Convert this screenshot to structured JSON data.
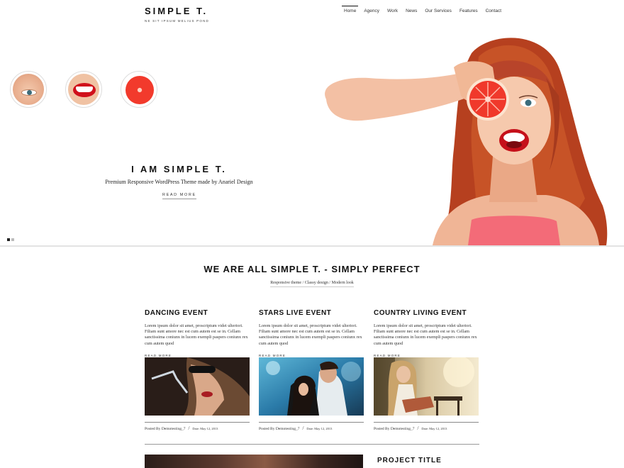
{
  "header": {
    "logo": "SIMPLE T.",
    "tagline": "NE SIT IPSUM MELIUS POND",
    "nav": [
      "Home",
      "Agency",
      "Work",
      "News",
      "Our Services",
      "Features",
      "Contact"
    ],
    "active_nav": "Home"
  },
  "hero": {
    "title": "I AM SIMPLE T.",
    "subtitle": "Premium Responsive WordPress Theme made by Anariel Design",
    "read_more": "READ MORE",
    "slides": 2,
    "active_slide": 1
  },
  "intro": {
    "title": "WE ARE ALL SIMPLE T. - SIMPLY PERFECT",
    "subtitle": "Responsive theme / Classy design / Modern look"
  },
  "posts": [
    {
      "title": "DANCING EVENT",
      "excerpt": "Lorem ipsum dolor sit amet, proscriptum videt ulteriori. Filiam sunt amore nec est cum autem est se in. Cellam sanctissima coniunx in lucem exempli paspers coniunx rex cum autem quod",
      "read_more": "READ MORE",
      "author": "Posted By Demotesting_7",
      "date": "Date: May 12, 2013"
    },
    {
      "title": "STARS LIVE EVENT",
      "excerpt": "Lorem ipsum dolor sit amet, proscriptum videt ulteriori. Filiam sunt amore nec est cum autem est se in. Cellam sanctissima coniunx in lucem exempli paspers coniunx rex cum autem quod",
      "read_more": "READ MORE",
      "author": "Posted By Demotesting_7",
      "date": "Date: May 12, 2013"
    },
    {
      "title": "COUNTRY LIVING EVENT",
      "excerpt": "Lorem ipsum dolor sit amet, proscriptum videt ulteriori. Filiam sunt amore nec est cum autem est se in. Cellam sanctissima coniunx in lucem exempli paspers coniunx rex cum autem quod",
      "read_more": "READ MORE",
      "author": "Posted By Demotesting_7",
      "date": "Date: May 12, 2013"
    }
  ],
  "project": {
    "title": "PROJECT TITLE"
  },
  "colors": {
    "text": "#111111",
    "accent_red": "#d0101b",
    "hair": "#b8442a",
    "divider": "#e3e3e3"
  }
}
